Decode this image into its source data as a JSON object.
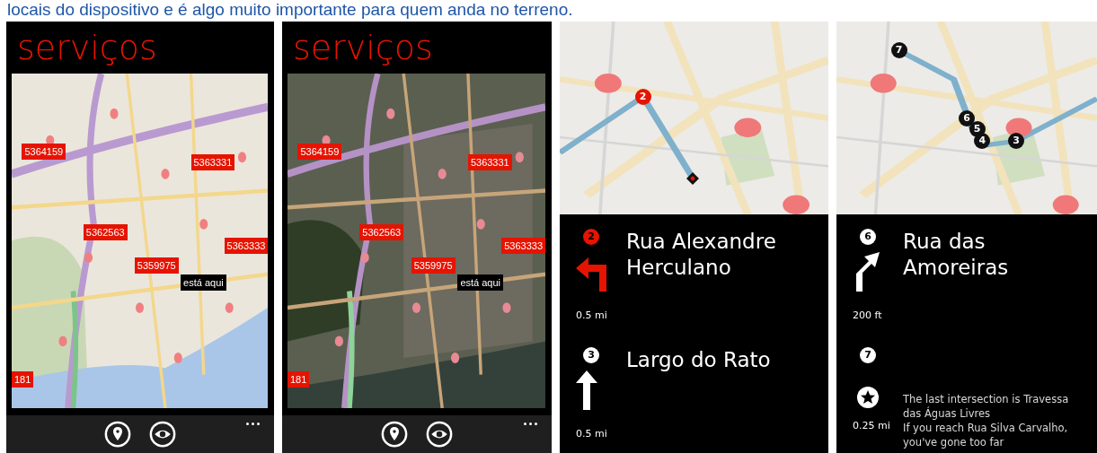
{
  "headline": "locais do dispositivo e é algo muito importante para quem anda no terreno.",
  "screens": [
    {
      "kind": "map",
      "title": "serviços",
      "map": {
        "kind": "road"
      },
      "pins": [
        {
          "label": "5364159",
          "kind": "service"
        },
        {
          "label": "5363331",
          "kind": "service"
        },
        {
          "label": "5362563",
          "kind": "service"
        },
        {
          "label": "5359975",
          "kind": "service"
        },
        {
          "label": "5363333",
          "kind": "service"
        },
        {
          "label": "está aqui",
          "kind": "you"
        },
        {
          "label": "181",
          "kind": "service"
        }
      ]
    },
    {
      "kind": "map",
      "title": "serviços",
      "map": {
        "kind": "aerial"
      },
      "pins": [
        {
          "label": "5364159",
          "kind": "service"
        },
        {
          "label": "5363331",
          "kind": "service"
        },
        {
          "label": "5362563",
          "kind": "service"
        },
        {
          "label": "5359975",
          "kind": "service"
        },
        {
          "label": "5363333",
          "kind": "service"
        },
        {
          "label": "está aqui",
          "kind": "you"
        },
        {
          "label": "181",
          "kind": "service"
        }
      ]
    },
    {
      "kind": "directions",
      "markers": [
        {
          "label": "2",
          "active": true
        }
      ],
      "steps": [
        {
          "kind": "street",
          "number": "2",
          "active": true,
          "arrow": {
            "kind": "left"
          },
          "distance": "0.5 mi",
          "text": "Rua Alexandre Herculano"
        },
        {
          "kind": "street",
          "number": "3",
          "active": false,
          "arrow": {
            "kind": "straight"
          },
          "distance": "0.5 mi",
          "text": "Largo do Rato"
        }
      ]
    },
    {
      "kind": "directions",
      "markers": [
        {
          "label": "7",
          "active": false
        },
        {
          "label": "6",
          "active": false
        },
        {
          "label": "5",
          "active": false
        },
        {
          "label": "4",
          "active": false
        },
        {
          "label": "3",
          "active": false
        }
      ],
      "steps": [
        {
          "kind": "street",
          "number": "6",
          "active": false,
          "arrow": {
            "kind": "right"
          },
          "distance": "200 ft",
          "text": "Rua das Amoreiras"
        },
        {
          "kind": "note",
          "number": "7",
          "active": false,
          "arrow": {
            "kind": "arrive"
          },
          "distance": "0.25 mi",
          "notes": [
            "The last intersection is Travessa das Águas Livres",
            "If you reach Rua Silva Carvalho, you've gone too far"
          ]
        }
      ]
    }
  ]
}
